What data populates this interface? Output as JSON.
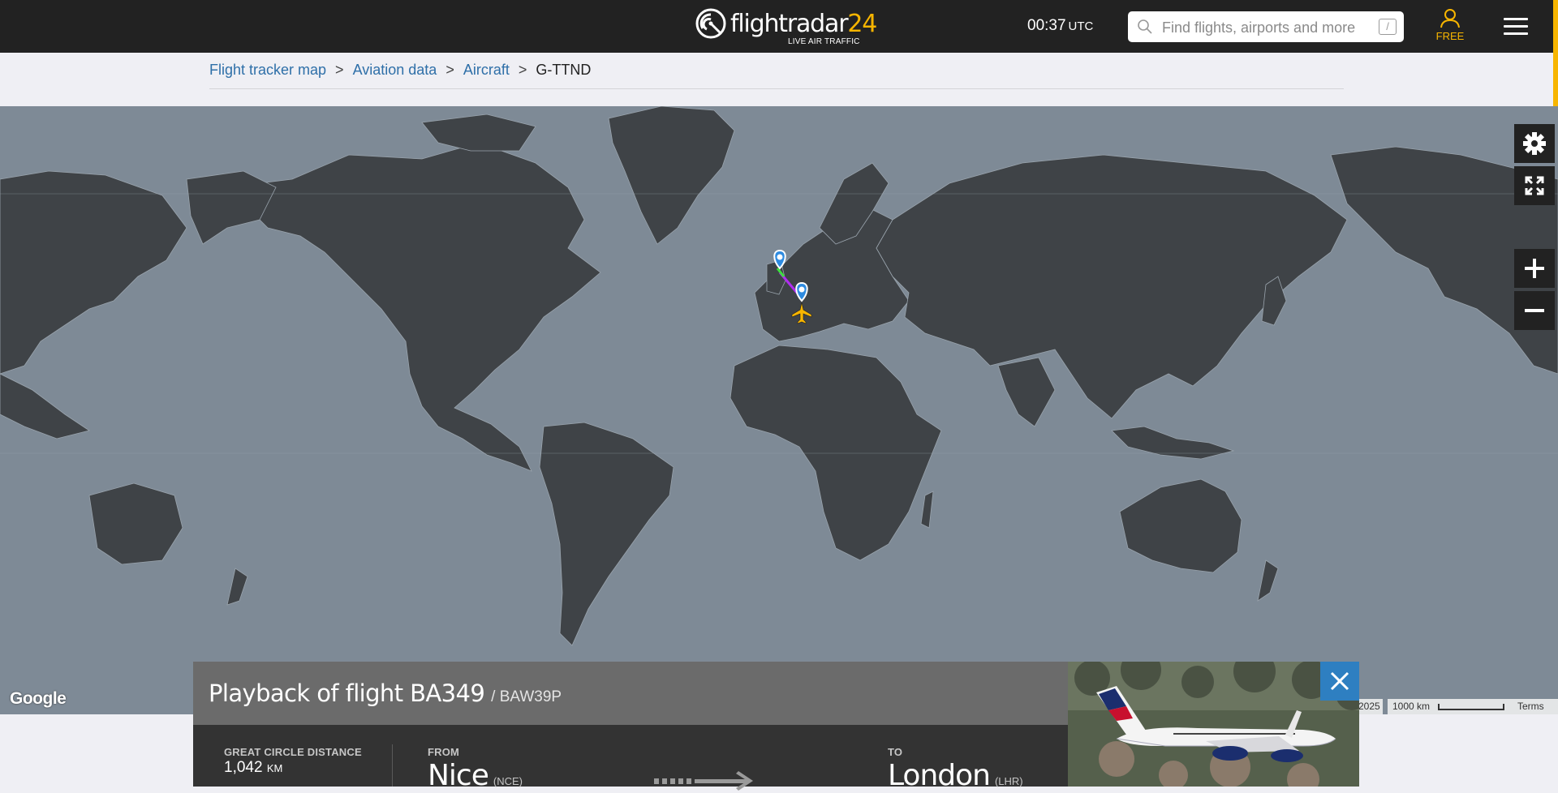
{
  "header": {
    "logo_text": "flightradar",
    "logo_number": "24",
    "logo_subtitle": "LIVE AIR TRAFFIC",
    "clock_time": "00:37",
    "clock_tz": "UTC",
    "search_placeholder": "Find flights, airports and more",
    "search_shortcut": "/",
    "user_label": "FREE"
  },
  "breadcrumb": {
    "items": [
      "Flight tracker map",
      "Aviation data",
      "Aircraft"
    ],
    "separator": ">",
    "current": "G-TTND"
  },
  "map": {
    "google_label": "Google",
    "year_attribution": "2025",
    "scale_label": "1000 km",
    "terms_label": "Terms",
    "water_color": "#7e8a96",
    "land_color": "#3f4347",
    "route_color": "#b02df0"
  },
  "flight_panel": {
    "title": "Playback of flight BA349",
    "callsign": "/ BAW39P",
    "distance_label": "GREAT CIRCLE DISTANCE",
    "distance_value": "1,042",
    "distance_unit": "KM",
    "from_label": "FROM",
    "from_city": "Nice",
    "from_code": "(NCE)",
    "to_label": "TO",
    "to_city": "London",
    "to_code": "(LHR)"
  },
  "icons": {
    "search": "search-icon",
    "user": "user-icon",
    "menu": "hamburger-icon",
    "settings": "gear-icon",
    "fullscreen": "fullscreen-icon",
    "zoom_in": "plus-icon",
    "zoom_out": "minus-icon",
    "close": "close-icon"
  },
  "colors": {
    "topbar": "#222222",
    "accent": "#f7b500",
    "link": "#2e6fa8",
    "close_button": "#2e7fc1"
  }
}
